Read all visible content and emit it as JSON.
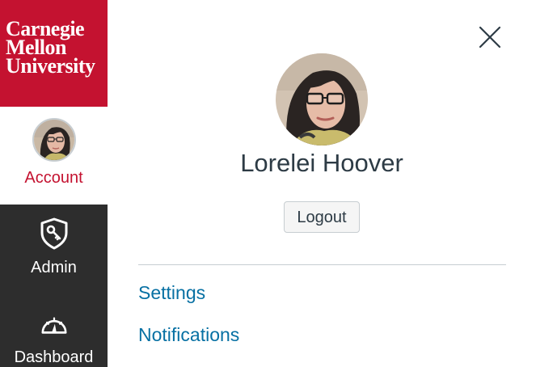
{
  "brand": {
    "logo_lines": [
      "Carnegie",
      "Mellon",
      "University"
    ],
    "color": "#c41230"
  },
  "global_nav": {
    "items": [
      {
        "label": "Account",
        "icon": "avatar",
        "active": true
      },
      {
        "label": "Admin",
        "icon": "admin-shield-icon"
      },
      {
        "label": "Dashboard",
        "icon": "dashboard-speedometer-icon"
      }
    ],
    "background": "#2d2d2d"
  },
  "tray": {
    "user_name": "Lorelei Hoover",
    "logout_label": "Logout",
    "links": [
      "Settings",
      "Notifications"
    ],
    "close_icon": "close-icon",
    "link_color": "#0770a3"
  }
}
